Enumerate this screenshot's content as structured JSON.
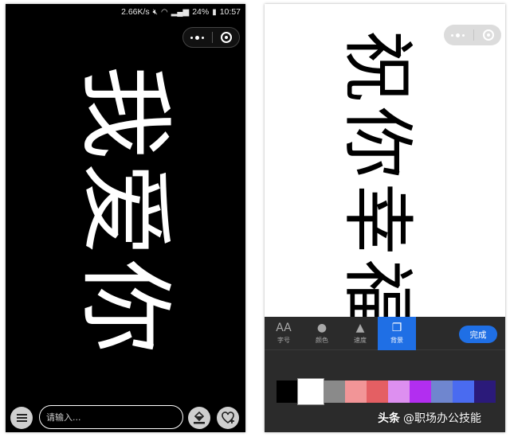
{
  "left_phone": {
    "status": {
      "speed": "2.66K/s",
      "battery": "24%",
      "time": "10:57"
    },
    "display_text": "我爱你",
    "input_placeholder": "请输入..."
  },
  "right_phone": {
    "display_text": "祝你幸福",
    "tabs": [
      {
        "label": "字号",
        "icon": "font-size-icon",
        "glyph": "AA"
      },
      {
        "label": "颜色",
        "icon": "color-drop-icon",
        "glyph": "●"
      },
      {
        "label": "速度",
        "icon": "speed-icon",
        "glyph": "▲"
      },
      {
        "label": "背景",
        "icon": "background-icon",
        "glyph": "❐"
      }
    ],
    "active_tab": "背景",
    "done_label": "完成",
    "swatch_colors": [
      "#000000",
      "#ffffff",
      "#8a8a8a",
      "#f29597",
      "#e45f63",
      "#dd8ff0",
      "#b22ef0",
      "#6f86cf",
      "#4a6bf0",
      "#2b1a7a"
    ],
    "selected_swatch": "#ffffff"
  },
  "watermark": {
    "brand": "头条",
    "handle": "@职场办公技能"
  }
}
